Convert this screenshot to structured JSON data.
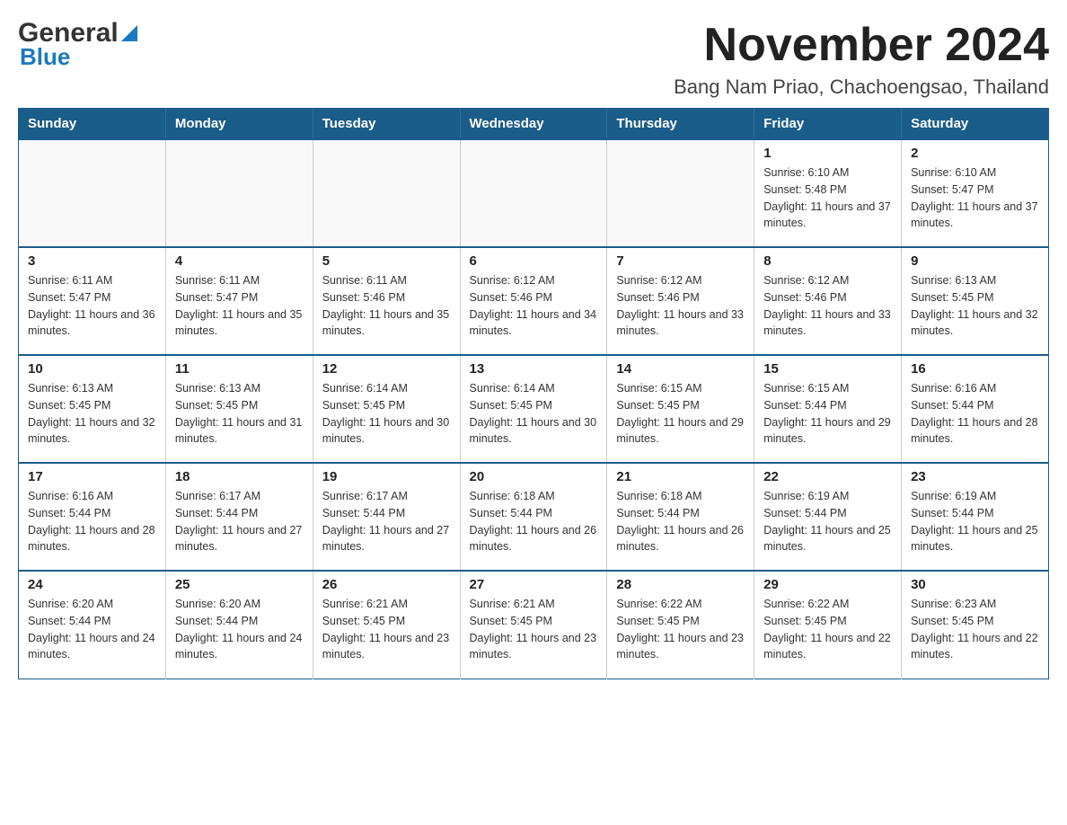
{
  "header": {
    "logo_top": "General",
    "logo_bottom": "Blue",
    "title": "November 2024",
    "subtitle": "Bang Nam Priao, Chachoengsao, Thailand"
  },
  "days_of_week": [
    "Sunday",
    "Monday",
    "Tuesday",
    "Wednesday",
    "Thursday",
    "Friday",
    "Saturday"
  ],
  "weeks": [
    [
      {
        "day": "",
        "info": ""
      },
      {
        "day": "",
        "info": ""
      },
      {
        "day": "",
        "info": ""
      },
      {
        "day": "",
        "info": ""
      },
      {
        "day": "",
        "info": ""
      },
      {
        "day": "1",
        "info": "Sunrise: 6:10 AM\nSunset: 5:48 PM\nDaylight: 11 hours and 37 minutes."
      },
      {
        "day": "2",
        "info": "Sunrise: 6:10 AM\nSunset: 5:47 PM\nDaylight: 11 hours and 37 minutes."
      }
    ],
    [
      {
        "day": "3",
        "info": "Sunrise: 6:11 AM\nSunset: 5:47 PM\nDaylight: 11 hours and 36 minutes."
      },
      {
        "day": "4",
        "info": "Sunrise: 6:11 AM\nSunset: 5:47 PM\nDaylight: 11 hours and 35 minutes."
      },
      {
        "day": "5",
        "info": "Sunrise: 6:11 AM\nSunset: 5:46 PM\nDaylight: 11 hours and 35 minutes."
      },
      {
        "day": "6",
        "info": "Sunrise: 6:12 AM\nSunset: 5:46 PM\nDaylight: 11 hours and 34 minutes."
      },
      {
        "day": "7",
        "info": "Sunrise: 6:12 AM\nSunset: 5:46 PM\nDaylight: 11 hours and 33 minutes."
      },
      {
        "day": "8",
        "info": "Sunrise: 6:12 AM\nSunset: 5:46 PM\nDaylight: 11 hours and 33 minutes."
      },
      {
        "day": "9",
        "info": "Sunrise: 6:13 AM\nSunset: 5:45 PM\nDaylight: 11 hours and 32 minutes."
      }
    ],
    [
      {
        "day": "10",
        "info": "Sunrise: 6:13 AM\nSunset: 5:45 PM\nDaylight: 11 hours and 32 minutes."
      },
      {
        "day": "11",
        "info": "Sunrise: 6:13 AM\nSunset: 5:45 PM\nDaylight: 11 hours and 31 minutes."
      },
      {
        "day": "12",
        "info": "Sunrise: 6:14 AM\nSunset: 5:45 PM\nDaylight: 11 hours and 30 minutes."
      },
      {
        "day": "13",
        "info": "Sunrise: 6:14 AM\nSunset: 5:45 PM\nDaylight: 11 hours and 30 minutes."
      },
      {
        "day": "14",
        "info": "Sunrise: 6:15 AM\nSunset: 5:45 PM\nDaylight: 11 hours and 29 minutes."
      },
      {
        "day": "15",
        "info": "Sunrise: 6:15 AM\nSunset: 5:44 PM\nDaylight: 11 hours and 29 minutes."
      },
      {
        "day": "16",
        "info": "Sunrise: 6:16 AM\nSunset: 5:44 PM\nDaylight: 11 hours and 28 minutes."
      }
    ],
    [
      {
        "day": "17",
        "info": "Sunrise: 6:16 AM\nSunset: 5:44 PM\nDaylight: 11 hours and 28 minutes."
      },
      {
        "day": "18",
        "info": "Sunrise: 6:17 AM\nSunset: 5:44 PM\nDaylight: 11 hours and 27 minutes."
      },
      {
        "day": "19",
        "info": "Sunrise: 6:17 AM\nSunset: 5:44 PM\nDaylight: 11 hours and 27 minutes."
      },
      {
        "day": "20",
        "info": "Sunrise: 6:18 AM\nSunset: 5:44 PM\nDaylight: 11 hours and 26 minutes."
      },
      {
        "day": "21",
        "info": "Sunrise: 6:18 AM\nSunset: 5:44 PM\nDaylight: 11 hours and 26 minutes."
      },
      {
        "day": "22",
        "info": "Sunrise: 6:19 AM\nSunset: 5:44 PM\nDaylight: 11 hours and 25 minutes."
      },
      {
        "day": "23",
        "info": "Sunrise: 6:19 AM\nSunset: 5:44 PM\nDaylight: 11 hours and 25 minutes."
      }
    ],
    [
      {
        "day": "24",
        "info": "Sunrise: 6:20 AM\nSunset: 5:44 PM\nDaylight: 11 hours and 24 minutes."
      },
      {
        "day": "25",
        "info": "Sunrise: 6:20 AM\nSunset: 5:44 PM\nDaylight: 11 hours and 24 minutes."
      },
      {
        "day": "26",
        "info": "Sunrise: 6:21 AM\nSunset: 5:45 PM\nDaylight: 11 hours and 23 minutes."
      },
      {
        "day": "27",
        "info": "Sunrise: 6:21 AM\nSunset: 5:45 PM\nDaylight: 11 hours and 23 minutes."
      },
      {
        "day": "28",
        "info": "Sunrise: 6:22 AM\nSunset: 5:45 PM\nDaylight: 11 hours and 23 minutes."
      },
      {
        "day": "29",
        "info": "Sunrise: 6:22 AM\nSunset: 5:45 PM\nDaylight: 11 hours and 22 minutes."
      },
      {
        "day": "30",
        "info": "Sunrise: 6:23 AM\nSunset: 5:45 PM\nDaylight: 11 hours and 22 minutes."
      }
    ]
  ]
}
